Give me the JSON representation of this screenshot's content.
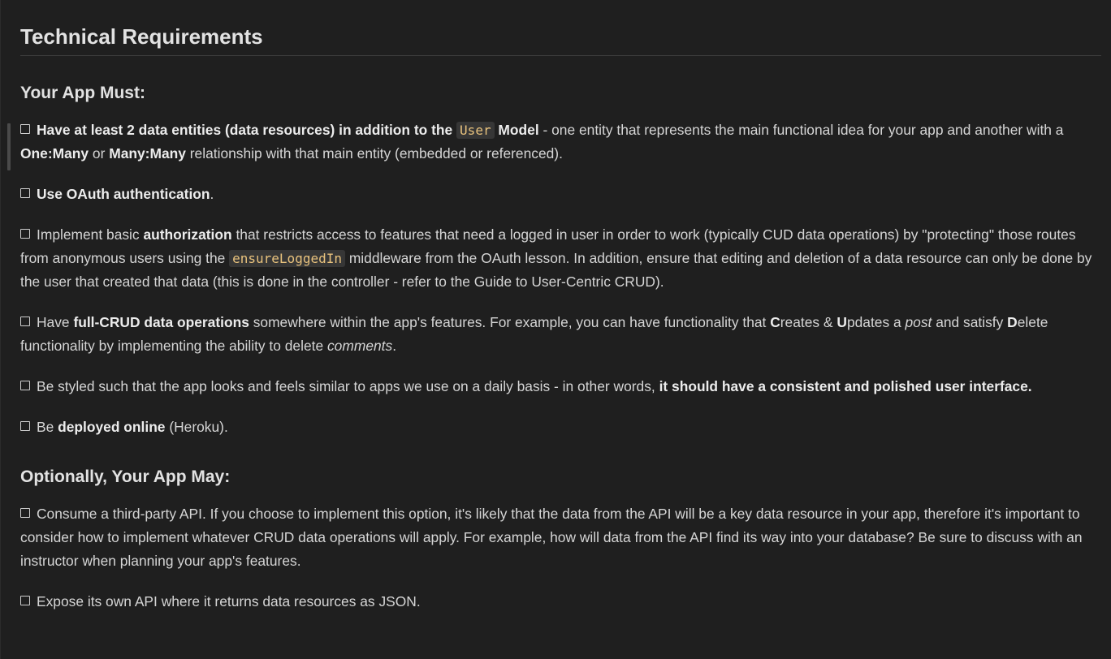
{
  "doc": {
    "title": "Technical Requirements",
    "must": {
      "heading": "Your App Must:",
      "item1": {
        "b1": "Have at least 2 data entities (data resources) in addition to the",
        "code": "User",
        "b2": "Model",
        "t1": " - one entity that represents the main functional idea for your app and another with a ",
        "b3": "One:Many",
        "t2": " or ",
        "b4": "Many:Many",
        "t3": " relationship with that main entity (embedded or referenced)."
      },
      "item2": {
        "b1": "Use OAuth authentication",
        "t1": "."
      },
      "item3": {
        "t1": "Implement basic ",
        "b1": "authorization",
        "t2": " that restricts access to features that need a logged in user in order to work (typically CUD data operations) by \"protecting\" those routes from anonymous users using the ",
        "code": "ensureLoggedIn",
        "t3": " middleware from the OAuth lesson. In addition, ensure that editing and deletion of a data resource can only be done by the user that created that data (this is done in the controller - refer to the Guide to User-Centric CRUD)."
      },
      "item4": {
        "t1": "Have ",
        "b1": "full-CRUD data operations",
        "t2": " somewhere within the app's features. For example, you can have functionality that ",
        "b2": "C",
        "t3": "reates & ",
        "b3": "U",
        "t4": "pdates a ",
        "i1": "post",
        "t5": " and satisfy ",
        "b4": "D",
        "t6": "elete functionality by implementing the ability to delete ",
        "i2": "comments",
        "t7": "."
      },
      "item5": {
        "t1": "Be styled such that the app looks and feels similar to apps we use on a daily basis - in other words, ",
        "b1": "it should have a consistent and polished user interface."
      },
      "item6": {
        "t1": "Be ",
        "b1": "deployed online",
        "t2": " (Heroku)."
      }
    },
    "may": {
      "heading": "Optionally, Your App May:",
      "item1": {
        "t1": "Consume a third-party API. If you choose to implement this option, it's likely that the data from the API will be a key data resource in your app, therefore it's important to consider how to implement whatever CRUD data operations will apply. For example, how will data from the API find its way into your database? Be sure to discuss with an instructor when planning your app's features."
      },
      "item2": {
        "t1": "Expose its own API where it returns data resources as JSON."
      }
    }
  }
}
